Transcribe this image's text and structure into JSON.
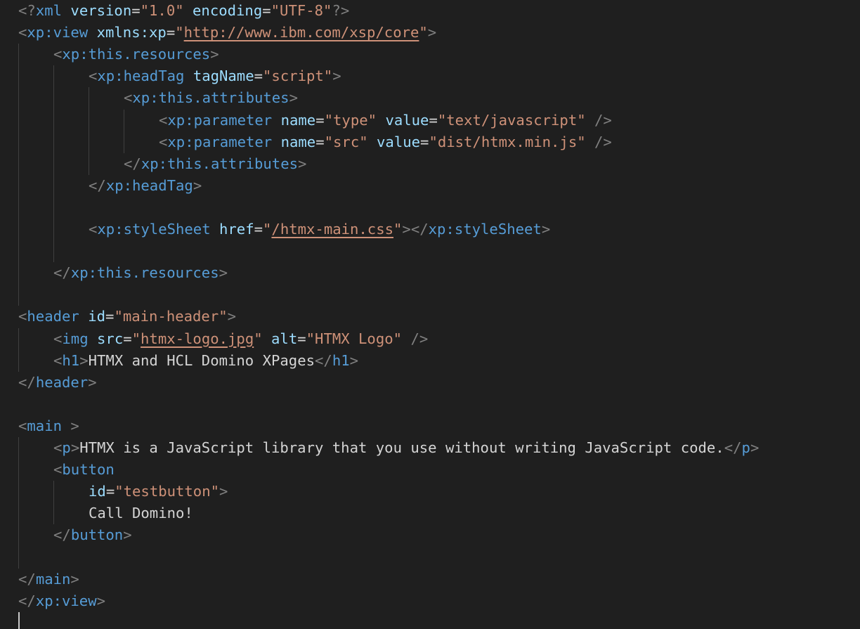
{
  "editor": {
    "language": "xml",
    "theme_colors": {
      "background": "#1f1f1f",
      "punctuation": "#808080",
      "tag": "#569cd6",
      "attribute": "#9cdcfe",
      "string": "#ce9178",
      "text": "#d4d4d4"
    },
    "lines": [
      {
        "indent": 0,
        "tokens": [
          {
            "k": "p",
            "v": "<?"
          },
          {
            "k": "t",
            "v": "xml"
          },
          {
            "k": "x",
            "v": " "
          },
          {
            "k": "a",
            "v": "version"
          },
          {
            "k": "e",
            "v": "="
          },
          {
            "k": "s",
            "v": "\"1.0\""
          },
          {
            "k": "x",
            "v": " "
          },
          {
            "k": "a",
            "v": "encoding"
          },
          {
            "k": "e",
            "v": "="
          },
          {
            "k": "s",
            "v": "\"UTF-8\""
          },
          {
            "k": "p",
            "v": "?>"
          }
        ]
      },
      {
        "indent": 0,
        "tokens": [
          {
            "k": "p",
            "v": "<"
          },
          {
            "k": "t",
            "v": "xp:view"
          },
          {
            "k": "x",
            "v": " "
          },
          {
            "k": "a",
            "v": "xmlns:xp"
          },
          {
            "k": "e",
            "v": "="
          },
          {
            "k": "s",
            "v": "\""
          },
          {
            "k": "u",
            "v": "http://www.ibm.com/xsp/core"
          },
          {
            "k": "s",
            "v": "\""
          },
          {
            "k": "p",
            "v": ">"
          }
        ]
      },
      {
        "indent": 1,
        "tokens": [
          {
            "k": "p",
            "v": "<"
          },
          {
            "k": "t",
            "v": "xp:this.resources"
          },
          {
            "k": "p",
            "v": ">"
          }
        ]
      },
      {
        "indent": 2,
        "tokens": [
          {
            "k": "p",
            "v": "<"
          },
          {
            "k": "t",
            "v": "xp:headTag"
          },
          {
            "k": "x",
            "v": " "
          },
          {
            "k": "a",
            "v": "tagName"
          },
          {
            "k": "e",
            "v": "="
          },
          {
            "k": "s",
            "v": "\"script\""
          },
          {
            "k": "p",
            "v": ">"
          }
        ]
      },
      {
        "indent": 3,
        "tokens": [
          {
            "k": "p",
            "v": "<"
          },
          {
            "k": "t",
            "v": "xp:this.attributes"
          },
          {
            "k": "p",
            "v": ">"
          }
        ]
      },
      {
        "indent": 4,
        "tokens": [
          {
            "k": "p",
            "v": "<"
          },
          {
            "k": "t",
            "v": "xp:parameter"
          },
          {
            "k": "x",
            "v": " "
          },
          {
            "k": "a",
            "v": "name"
          },
          {
            "k": "e",
            "v": "="
          },
          {
            "k": "s",
            "v": "\"type\""
          },
          {
            "k": "x",
            "v": " "
          },
          {
            "k": "a",
            "v": "value"
          },
          {
            "k": "e",
            "v": "="
          },
          {
            "k": "s",
            "v": "\"text/javascript\""
          },
          {
            "k": "x",
            "v": " "
          },
          {
            "k": "p",
            "v": "/>"
          }
        ]
      },
      {
        "indent": 4,
        "tokens": [
          {
            "k": "p",
            "v": "<"
          },
          {
            "k": "t",
            "v": "xp:parameter"
          },
          {
            "k": "x",
            "v": " "
          },
          {
            "k": "a",
            "v": "name"
          },
          {
            "k": "e",
            "v": "="
          },
          {
            "k": "s",
            "v": "\"src\""
          },
          {
            "k": "x",
            "v": " "
          },
          {
            "k": "a",
            "v": "value"
          },
          {
            "k": "e",
            "v": "="
          },
          {
            "k": "s",
            "v": "\"dist/htmx.min.js\""
          },
          {
            "k": "x",
            "v": " "
          },
          {
            "k": "p",
            "v": "/>"
          }
        ]
      },
      {
        "indent": 3,
        "tokens": [
          {
            "k": "p",
            "v": "</"
          },
          {
            "k": "t",
            "v": "xp:this.attributes"
          },
          {
            "k": "p",
            "v": ">"
          }
        ]
      },
      {
        "indent": 2,
        "tokens": [
          {
            "k": "p",
            "v": "</"
          },
          {
            "k": "t",
            "v": "xp:headTag"
          },
          {
            "k": "p",
            "v": ">"
          }
        ]
      },
      {
        "indent": 2,
        "tokens": []
      },
      {
        "indent": 2,
        "tokens": [
          {
            "k": "p",
            "v": "<"
          },
          {
            "k": "t",
            "v": "xp:styleSheet"
          },
          {
            "k": "x",
            "v": " "
          },
          {
            "k": "a",
            "v": "href"
          },
          {
            "k": "e",
            "v": "="
          },
          {
            "k": "s",
            "v": "\""
          },
          {
            "k": "u",
            "v": "/htmx-main.css"
          },
          {
            "k": "s",
            "v": "\""
          },
          {
            "k": "p",
            "v": "></"
          },
          {
            "k": "t",
            "v": "xp:styleSheet"
          },
          {
            "k": "p",
            "v": ">"
          }
        ]
      },
      {
        "indent": 2,
        "tokens": []
      },
      {
        "indent": 1,
        "tokens": [
          {
            "k": "p",
            "v": "</"
          },
          {
            "k": "t",
            "v": "xp:this.resources"
          },
          {
            "k": "p",
            "v": ">"
          }
        ]
      },
      {
        "indent": 1,
        "tokens": []
      },
      {
        "indent": 0,
        "tokens": [
          {
            "k": "p",
            "v": "<"
          },
          {
            "k": "t",
            "v": "header"
          },
          {
            "k": "x",
            "v": " "
          },
          {
            "k": "a",
            "v": "id"
          },
          {
            "k": "e",
            "v": "="
          },
          {
            "k": "s",
            "v": "\"main-header\""
          },
          {
            "k": "p",
            "v": ">"
          }
        ]
      },
      {
        "indent": 1,
        "tokens": [
          {
            "k": "p",
            "v": "<"
          },
          {
            "k": "t",
            "v": "img"
          },
          {
            "k": "x",
            "v": " "
          },
          {
            "k": "a",
            "v": "src"
          },
          {
            "k": "e",
            "v": "="
          },
          {
            "k": "s",
            "v": "\""
          },
          {
            "k": "u",
            "v": "htmx-logo.jpg"
          },
          {
            "k": "s",
            "v": "\""
          },
          {
            "k": "x",
            "v": " "
          },
          {
            "k": "a",
            "v": "alt"
          },
          {
            "k": "e",
            "v": "="
          },
          {
            "k": "s",
            "v": "\"HTMX Logo\""
          },
          {
            "k": "x",
            "v": " "
          },
          {
            "k": "p",
            "v": "/>"
          }
        ]
      },
      {
        "indent": 1,
        "tokens": [
          {
            "k": "p",
            "v": "<"
          },
          {
            "k": "t",
            "v": "h1"
          },
          {
            "k": "p",
            "v": ">"
          },
          {
            "k": "x",
            "v": "HTMX and HCL Domino XPages"
          },
          {
            "k": "p",
            "v": "</"
          },
          {
            "k": "t",
            "v": "h1"
          },
          {
            "k": "p",
            "v": ">"
          }
        ]
      },
      {
        "indent": 0,
        "tokens": [
          {
            "k": "p",
            "v": "</"
          },
          {
            "k": "t",
            "v": "header"
          },
          {
            "k": "p",
            "v": ">"
          }
        ]
      },
      {
        "indent": 0,
        "tokens": []
      },
      {
        "indent": 0,
        "tokens": [
          {
            "k": "p",
            "v": "<"
          },
          {
            "k": "t",
            "v": "main"
          },
          {
            "k": "x",
            "v": " "
          },
          {
            "k": "p",
            "v": ">"
          }
        ]
      },
      {
        "indent": 1,
        "tokens": [
          {
            "k": "p",
            "v": "<"
          },
          {
            "k": "t",
            "v": "p"
          },
          {
            "k": "p",
            "v": ">"
          },
          {
            "k": "x",
            "v": "HTMX is a JavaScript library that you use without writing JavaScript code."
          },
          {
            "k": "p",
            "v": "</"
          },
          {
            "k": "t",
            "v": "p"
          },
          {
            "k": "p",
            "v": ">"
          }
        ]
      },
      {
        "indent": 1,
        "tokens": [
          {
            "k": "p",
            "v": "<"
          },
          {
            "k": "t",
            "v": "button"
          }
        ]
      },
      {
        "indent": 2,
        "tokens": [
          {
            "k": "a",
            "v": "id"
          },
          {
            "k": "e",
            "v": "="
          },
          {
            "k": "s",
            "v": "\"testbutton\""
          },
          {
            "k": "p",
            "v": ">"
          }
        ]
      },
      {
        "indent": 2,
        "tokens": [
          {
            "k": "x",
            "v": "Call Domino!"
          }
        ]
      },
      {
        "indent": 1,
        "tokens": [
          {
            "k": "p",
            "v": "</"
          },
          {
            "k": "t",
            "v": "button"
          },
          {
            "k": "p",
            "v": ">"
          }
        ]
      },
      {
        "indent": 1,
        "tokens": []
      },
      {
        "indent": 0,
        "tokens": [
          {
            "k": "p",
            "v": "</"
          },
          {
            "k": "t",
            "v": "main"
          },
          {
            "k": "p",
            "v": ">"
          }
        ]
      },
      {
        "indent": 0,
        "tokens": [
          {
            "k": "p",
            "v": "</"
          },
          {
            "k": "t",
            "v": "xp:view"
          },
          {
            "k": "p",
            "v": ">"
          }
        ]
      }
    ]
  }
}
